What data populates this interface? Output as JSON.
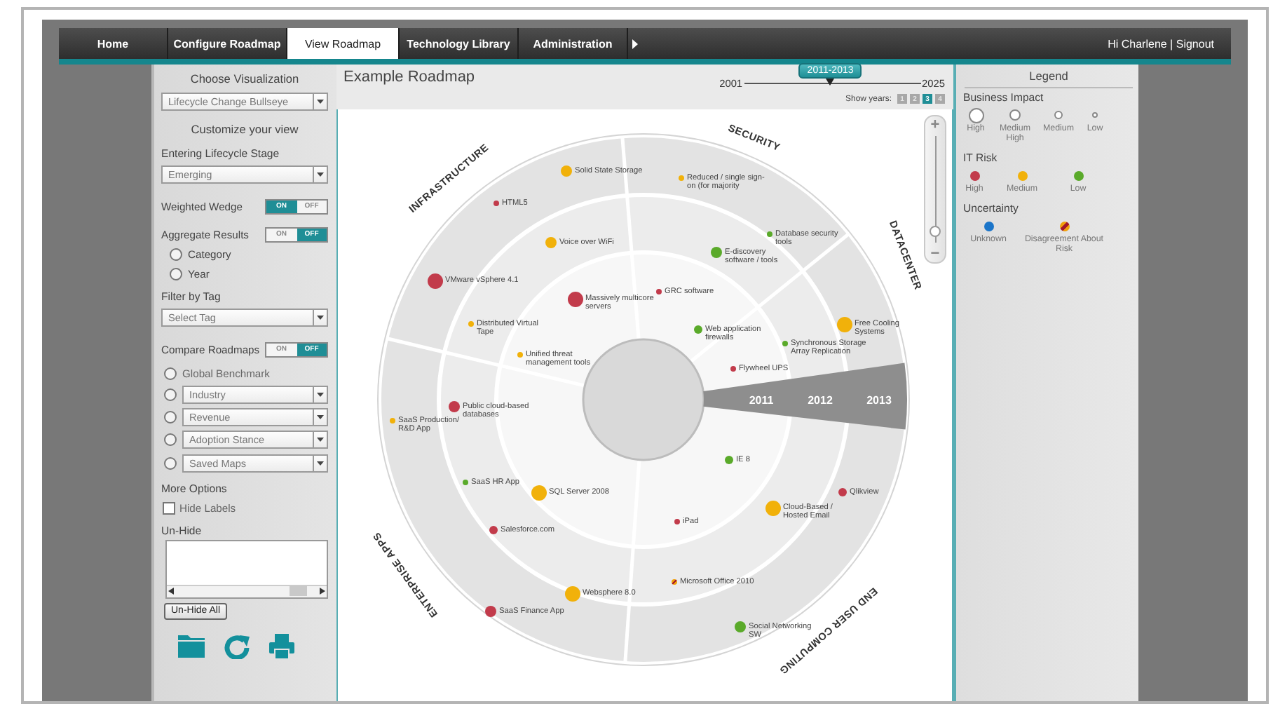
{
  "nav": {
    "tabs": [
      {
        "label": "Home",
        "selected": false
      },
      {
        "label": "Configure Roadmap",
        "selected": false
      },
      {
        "label": "View Roadmap",
        "selected": true
      },
      {
        "label": "Technology Library",
        "selected": false
      },
      {
        "label": "Administration",
        "selected": false
      }
    ],
    "user_links": "Hi Charlene | Signout"
  },
  "sidebar": {
    "controls": [
      {
        "kind": "heading",
        "text": "Choose Visualization"
      },
      {
        "kind": "dropdown",
        "value": "Lifecycle Change Bullseye"
      },
      {
        "kind": "heading",
        "text": "Customize your view"
      },
      {
        "kind": "label",
        "text": "Entering Lifecycle Stage"
      },
      {
        "kind": "dropdown",
        "value": "Emerging"
      },
      {
        "kind": "toggle",
        "label": "Weighted Wedge",
        "on_text": "ON",
        "off_text": "OFF",
        "on": true
      },
      {
        "kind": "toggle",
        "label": "Aggregate Results",
        "on_text": "ON",
        "off_text": "OFF",
        "on": false
      },
      {
        "kind": "radio",
        "label": "Category",
        "selected": false
      },
      {
        "kind": "radio",
        "label": "Year",
        "selected": false
      },
      {
        "kind": "label",
        "text": "Filter by Tag"
      },
      {
        "kind": "dropdown",
        "value": "Select Tag"
      },
      {
        "kind": "toggle",
        "label": "Compare Roadmaps",
        "on_text": "ON",
        "off_text": "OFF",
        "on": false
      },
      {
        "kind": "radio",
        "label": "Global Benchmark",
        "selected": false
      },
      {
        "kind": "radio_dropdown",
        "value": "Industry",
        "selected": false
      },
      {
        "kind": "radio_dropdown",
        "value": "Revenue",
        "selected": false
      },
      {
        "kind": "radio_dropdown",
        "value": "Adoption Stance",
        "selected": false
      },
      {
        "kind": "radio_dropdown",
        "value": "Saved Maps",
        "selected": false
      },
      {
        "kind": "label",
        "text": "More Options"
      },
      {
        "kind": "checkbox",
        "label": "Hide Labels",
        "checked": false
      },
      {
        "kind": "label",
        "text": "Un-Hide"
      },
      {
        "kind": "listbox"
      },
      {
        "kind": "button",
        "label": "Un-Hide All"
      }
    ]
  },
  "roadmap": {
    "title": "Example Roadmap",
    "timeline": {
      "start": "2001",
      "end": "2025",
      "range": "2011-2013",
      "level": 0.49
    },
    "show_years": {
      "label": "Show years:",
      "buttons": [
        {
          "label": "1",
          "selected": false
        },
        {
          "label": "2",
          "selected": false
        },
        {
          "label": "3",
          "selected": true
        },
        {
          "label": "4",
          "selected": false
        }
      ]
    },
    "zoom": {
      "plus": "+",
      "minus": "−",
      "level": 0.1
    },
    "sectors": [
      "INFRASTRUCTURE",
      "SECURITY",
      "DATACENTER",
      "END USER COMPUTING",
      "ENTERPRISE APPS"
    ],
    "years": [
      "2011",
      "2012",
      "2013"
    ],
    "items": [
      {
        "label": "Solid State Storage",
        "color": "#f1b10a",
        "kind": "big",
        "disagreement": false
      },
      {
        "label": "HTML5",
        "color": "#c23b4b",
        "kind": "small",
        "disagreement": false
      },
      {
        "label": "Voice over WiFi",
        "color": "#f1b10a",
        "kind": "big",
        "disagreement": false
      },
      {
        "label": "VMware vSphere 4.1",
        "color": "#c23b4b",
        "kind": "large",
        "disagreement": false
      },
      {
        "label": "Massively multicore servers",
        "color": "#c23b4b",
        "kind": "large",
        "disagreement": false
      },
      {
        "label": "GRC software",
        "color": "#c23b4b",
        "kind": "small",
        "disagreement": false
      },
      {
        "label": "Distributed Virtual Tape",
        "color": "#f1b10a",
        "kind": "small",
        "disagreement": false
      },
      {
        "label": "Unified threat management tools",
        "color": "#f1b10a",
        "kind": "small",
        "disagreement": false
      },
      {
        "label": "Reduced / single sign-on (for majority",
        "color": "#f1b10a",
        "kind": "small",
        "disagreement": false
      },
      {
        "label": "Database security tools",
        "color": "#5aaa2a",
        "kind": "small",
        "disagreement": false
      },
      {
        "label": "E-discovery software / tools",
        "color": "#5aaa2a",
        "kind": "big",
        "disagreement": false
      },
      {
        "label": "Web application firewalls",
        "color": "#5aaa2a",
        "kind": "medium",
        "disagreement": false
      },
      {
        "label": "Free Cooling Systems",
        "color": "#f1b10a",
        "kind": "large",
        "disagreement": false
      },
      {
        "label": "Synchronous Storage Array Replication",
        "color": "#5aaa2a",
        "kind": "small",
        "disagreement": false
      },
      {
        "label": "Flywheel UPS",
        "color": "#c23b4b",
        "kind": "small",
        "disagreement": false
      },
      {
        "label": "Public cloud-based databases",
        "color": "#c23b4b",
        "kind": "big",
        "disagreement": false
      },
      {
        "label": "SaaS Production/ R&D App",
        "color": "#f1b10a",
        "kind": "small",
        "disagreement": false
      },
      {
        "label": "SaaS HR App",
        "color": "#5aaa2a",
        "kind": "small",
        "disagreement": false
      },
      {
        "label": "SQL Server 2008",
        "color": "#f1b10a",
        "kind": "large",
        "disagreement": false
      },
      {
        "label": "Salesforce.com",
        "color": "#c23b4b",
        "kind": "medium",
        "disagreement": false
      },
      {
        "label": "Websphere 8.0",
        "color": "#f1b10a",
        "kind": "large",
        "disagreement": false
      },
      {
        "label": "SaaS Finance App",
        "color": "#c23b4b",
        "kind": "big",
        "disagreement": false
      },
      {
        "label": "IE 8",
        "color": "#5aaa2a",
        "kind": "medium",
        "disagreement": false
      },
      {
        "label": "Qlikview",
        "color": "#c23b4b",
        "kind": "medium",
        "disagreement": false
      },
      {
        "label": "Cloud-Based / Hosted Email",
        "color": "#f1b10a",
        "kind": "large",
        "disagreement": false
      },
      {
        "label": "iPad",
        "color": "#c23b4b",
        "kind": "small",
        "disagreement": false
      },
      {
        "label": "Microsoft Office 2010",
        "color": "#f1a00a",
        "kind": "small",
        "disagreement": true
      },
      {
        "label": "Social Networking SW",
        "color": "#5aaa2a",
        "kind": "big",
        "disagreement": false
      }
    ]
  },
  "legend": {
    "title": "Legend",
    "groups": [
      {
        "title": "Business Impact",
        "entries": [
          {
            "label": "High",
            "kind": "large"
          },
          {
            "label": "Medium High",
            "kind": "big"
          },
          {
            "label": "Medium",
            "kind": "medium"
          },
          {
            "label": "Low",
            "kind": "small"
          }
        ]
      },
      {
        "title": "IT Risk",
        "entries": [
          {
            "label": "High",
            "kind": "dot",
            "color": "#c23b4b"
          },
          {
            "label": "Medium",
            "kind": "dot",
            "color": "#f1b10a"
          },
          {
            "label": "Low",
            "kind": "dot",
            "color": "#5aaa2a"
          }
        ]
      },
      {
        "title": "Uncertainty",
        "entries": [
          {
            "label": "Unknown",
            "kind": "dot",
            "color": "#1b75c9"
          },
          {
            "label": "Disagreement About Risk",
            "kind": "disagreement",
            "color": "#f1a00a"
          }
        ]
      }
    ]
  }
}
